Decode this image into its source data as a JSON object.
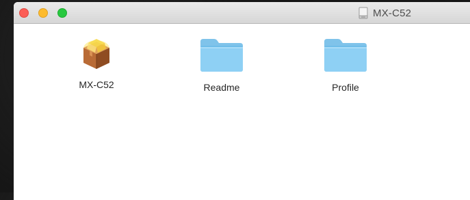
{
  "window": {
    "title": "MX-C52",
    "title_icon": "disk-image-icon"
  },
  "traffic_lights": {
    "close_color": "#fc5e57",
    "minimize_color": "#fdbb2e",
    "zoom_color": "#28c840"
  },
  "items": [
    {
      "label": "MX-C52",
      "icon": "package-installer-icon"
    },
    {
      "label": "Readme",
      "icon": "folder-icon"
    },
    {
      "label": "Profile",
      "icon": "folder-icon"
    }
  ]
}
